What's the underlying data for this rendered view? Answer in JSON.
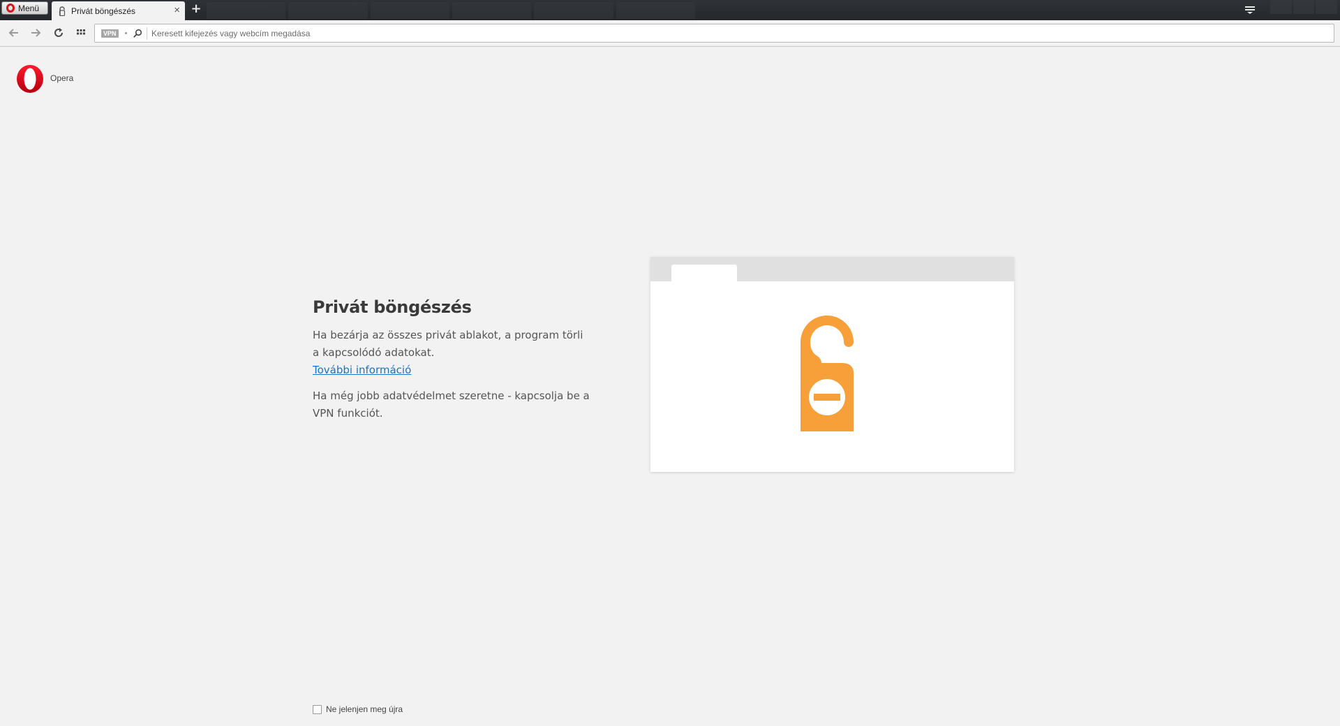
{
  "browser": {
    "menu_label": "Menü",
    "active_tab": {
      "title": "Privát böngészés",
      "close_glyph": "×"
    },
    "new_tab_glyph": "+",
    "address_bar": {
      "vpn_label": "VPN",
      "placeholder": "Keresett kifejezés vagy webcím megadása"
    },
    "icons": {
      "back": "arrow-left-icon",
      "forward": "arrow-right-icon",
      "reload": "reload-icon",
      "speed_dial": "grid-icon",
      "search": "search-icon",
      "tabs_menu": "tabs-list-icon"
    }
  },
  "page": {
    "brand": "Opera",
    "title": "Privát böngészés",
    "paragraph1": "Ha bezárja az összes privát ablakot, a program törli a kapcsolódó adatokat.",
    "more_info_link": "További információ",
    "paragraph2": "Ha még jobb adatvédelmet szeretne - kapcsolja be a VPN funkciót.",
    "dont_show_again": "Ne jelenjen meg újra"
  },
  "colors": {
    "opera_red": "#d7141a",
    "hanger_orange": "#f7a03a",
    "link_blue": "#1a73c9",
    "page_bg": "#f2f2f2"
  }
}
